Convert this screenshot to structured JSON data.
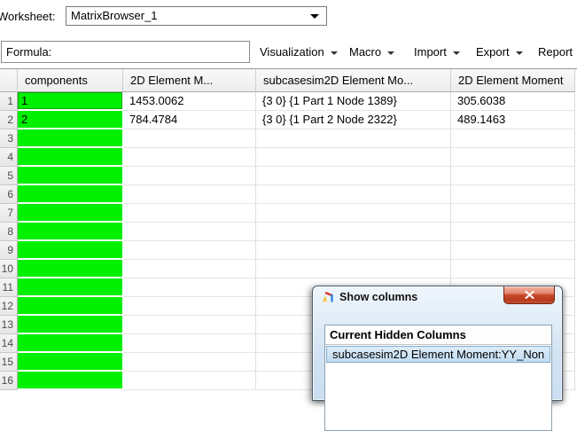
{
  "worksheet_bar": {
    "label": "Worksheet:",
    "value": "MatrixBrowser_1"
  },
  "formula_bar": {
    "label": "Formula:"
  },
  "menus": [
    {
      "label": "Visualization",
      "has_arrow": true
    },
    {
      "label": "Macro",
      "has_arrow": true
    },
    {
      "label": "Import",
      "has_arrow": true
    },
    {
      "label": "Export",
      "has_arrow": true
    },
    {
      "label": "Report",
      "has_arrow": true
    }
  ],
  "table": {
    "columns": [
      "",
      "components",
      "2D Element M...",
      "subcasesim2D Element Mo...",
      "2D Element Moment"
    ],
    "highlight_color": "#00f000",
    "rows": [
      {
        "num": "1",
        "components": "1",
        "col2": "1453.0062",
        "col3": "{3 0} {1 Part 1 Node 1389}",
        "col4": "305.6038"
      },
      {
        "num": "2",
        "components": "2",
        "col2": "784.4784",
        "col3": "{3 0} {1 Part 2 Node 2322}",
        "col4": "489.1463"
      },
      {
        "num": "3",
        "components": "",
        "col2": "",
        "col3": "",
        "col4": ""
      },
      {
        "num": "4",
        "components": "",
        "col2": "",
        "col3": "",
        "col4": ""
      },
      {
        "num": "5",
        "components": "",
        "col2": "",
        "col3": "",
        "col4": ""
      },
      {
        "num": "6",
        "components": "",
        "col2": "",
        "col3": "",
        "col4": ""
      },
      {
        "num": "7",
        "components": "",
        "col2": "",
        "col3": "",
        "col4": ""
      },
      {
        "num": "8",
        "components": "",
        "col2": "",
        "col3": "",
        "col4": ""
      },
      {
        "num": "9",
        "components": "",
        "col2": "",
        "col3": "",
        "col4": ""
      },
      {
        "num": "10",
        "components": "",
        "col2": "",
        "col3": "",
        "col4": ""
      },
      {
        "num": "11",
        "components": "",
        "col2": "",
        "col3": "",
        "col4": ""
      },
      {
        "num": "12",
        "components": "",
        "col2": "",
        "col3": "",
        "col4": ""
      },
      {
        "num": "13",
        "components": "",
        "col2": "",
        "col3": "",
        "col4": ""
      },
      {
        "num": "14",
        "components": "",
        "col2": "",
        "col3": "",
        "col4": ""
      },
      {
        "num": "15",
        "components": "",
        "col2": "",
        "col3": "",
        "col4": ""
      },
      {
        "num": "16",
        "components": "",
        "col2": "",
        "col3": "",
        "col4": ""
      }
    ]
  },
  "dialog": {
    "title": "Show columns",
    "list_header": "Current Hidden Columns",
    "items": [
      "subcasesim2D Element Moment:YY_Non"
    ],
    "selection_color": "#c3dcf1",
    "close_button_color": "#c4421f"
  }
}
